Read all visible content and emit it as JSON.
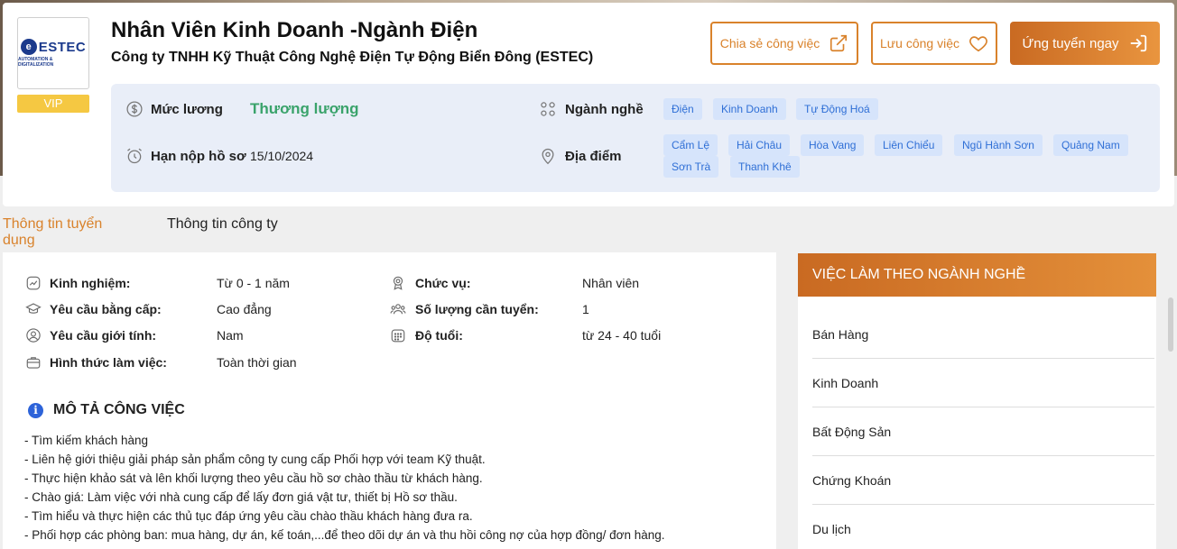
{
  "header": {
    "logo_text": "ESTEC",
    "logo_sub": "AUTOMATION & DIGITALIZATION",
    "vip_label": "VIP",
    "job_title": "Nhân Viên Kinh Doanh -Ngành Điện",
    "company_name": "Công ty TNHH Kỹ Thuật Công Nghệ Điện Tự Động Biển Đông (ESTEC)",
    "share_label": "Chia sẻ công việc",
    "save_label": "Lưu công việc",
    "apply_label": "Ứng tuyển ngay"
  },
  "info": {
    "salary_label": "Mức lương",
    "salary_value": "Thương lượng",
    "deadline_label": "Hạn nộp hồ sơ",
    "deadline_value": "15/10/2024",
    "industry_label": "Ngành nghề",
    "industries": [
      "Điện",
      "Kinh Doanh",
      "Tự Động Hoá"
    ],
    "location_label": "Địa điểm",
    "locations": [
      "Cẩm Lệ",
      "Hải Châu",
      "Hòa Vang",
      "Liên Chiểu",
      "Ngũ Hành Sơn",
      "Quảng Nam",
      "Sơn Trà",
      "Thanh Khê"
    ]
  },
  "tabs": [
    "Thông tin tuyển dụng",
    "Thông tin công ty"
  ],
  "details": {
    "experience_label": "Kinh nghiệm:",
    "experience_value": "Từ 0 - 1 năm",
    "degree_label": "Yêu cầu bằng cấp:",
    "degree_value": "Cao đẳng",
    "gender_label": "Yêu cầu giới tính:",
    "gender_value": "Nam",
    "worktype_label": "Hình thức làm việc:",
    "worktype_value": "Toàn thời gian",
    "position_label": "Chức vụ:",
    "position_value": "Nhân viên",
    "headcount_label": "Số lượng cần tuyển:",
    "headcount_value": "1",
    "age_label": "Độ tuổi:",
    "age_value": "từ 24 - 40 tuổi"
  },
  "description": {
    "title": "MÔ TẢ CÔNG VIỆC",
    "lines": [
      "- Tìm kiếm khách hàng",
      "- Liên hệ giới thiệu giải pháp sản phẩm công ty cung cấp Phối hợp với team Kỹ thuật.",
      "- Thực hiện khảo sát và lên khối lượng theo yêu cầu hồ sơ chào thầu từ khách hàng.",
      "- Chào giá: Làm việc với nhà cung cấp để lấy đơn giá vật tư, thiết bị Hồ sơ thầu.",
      "- Tìm hiểu và thực hiện các thủ tục đáp ứng yêu cầu chào thầu khách hàng đưa ra.",
      "- Phối hợp các phòng ban: mua hàng, dự án, kế toán,...để theo dõi dự án và thu hồi công nợ của hợp đồng/ đơn hàng."
    ]
  },
  "sidebar": {
    "title": "VIỆC LÀM THEO NGÀNH NGHỀ",
    "items": [
      "Bán Hàng",
      "Kinh Doanh",
      "Bất Động Sản",
      "Chứng Khoán",
      "Du lịch"
    ]
  },
  "colors": {
    "accent": "#d9822b",
    "salary": "#3aa36b",
    "tag_bg": "#d6e4fb",
    "tag_text": "#2f6fd6"
  }
}
